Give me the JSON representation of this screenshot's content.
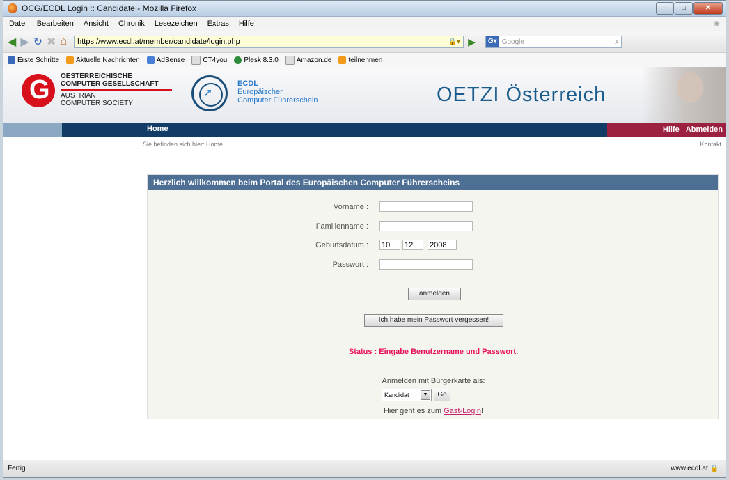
{
  "window": {
    "title": "OCG/ECDL Login :: Candidate - Mozilla Firefox"
  },
  "menu": [
    "Datei",
    "Bearbeiten",
    "Ansicht",
    "Chronik",
    "Lesezeichen",
    "Extras",
    "Hilfe"
  ],
  "nav": {
    "url": "https://www.ecdl.at/member/candidate/login.php",
    "search_placeholder": "Google"
  },
  "bookmarks": [
    "Erste Schritte",
    "Aktuelle Nachrichten",
    "AdSense",
    "CT4you",
    "Plesk 8.3.0",
    "Amazon.de",
    "teilnehmen"
  ],
  "header": {
    "ocg_lines": [
      "OESTERREICHISCHE",
      "COMPUTER GESELLSCHAFT",
      "AUSTRIAN",
      "COMPUTER SOCIETY"
    ],
    "ecdl_lines": [
      "ECDL",
      "Europäischer",
      "Computer Führerschein"
    ],
    "title": "OETZI Österreich"
  },
  "navstrip": {
    "home": "Home",
    "hilfe": "Hilfe",
    "abmelden": "Abmelden"
  },
  "crumb": {
    "text": "Sie befinden sich hier: Home",
    "kontakt": "Kontakt"
  },
  "panel": {
    "heading": "Herzlich willkommen beim Portal des Europäischen Computer Führerscheins",
    "labels": {
      "vorname": "Vorname :",
      "familienname": "Familienname :",
      "geburtsdatum": "Geburtsdatum :",
      "passwort": "Passwort :"
    },
    "birth": {
      "day": "10",
      "month": "12",
      "year": "2008"
    },
    "login_button": "anmelden",
    "forgot_button": "Ich habe mein Passwort vergessen!",
    "status": "Status : Eingabe Benutzername und Passwort.",
    "buergerkarte_label": "Anmelden mit Bürgerkarte als:",
    "role_selected": "Kandidat",
    "go_button": "Go",
    "guest_prefix": "Hier geht es zum",
    "guest_link": "Gast-Login",
    "guest_suffix": "!"
  },
  "statusbar": {
    "left": "Fertig",
    "right": "www.ecdl.at"
  }
}
